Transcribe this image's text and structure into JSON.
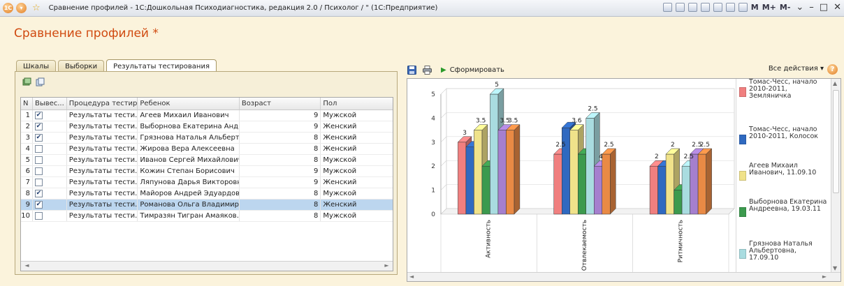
{
  "window": {
    "title": "Сравнение профилей - 1С:Дошкольная Психодиагностика, редакция 2.0 / Психолог / \" (1С:Предприятие)",
    "toolbar_m_labels": [
      "M",
      "M+",
      "M-"
    ]
  },
  "form": {
    "title": "Сравнение профилей *"
  },
  "tabs": [
    {
      "label": "Шкалы"
    },
    {
      "label": "Выборки"
    },
    {
      "label": "Результаты тестирования"
    }
  ],
  "table": {
    "columns": [
      "N",
      "Вывес...",
      "Процедура тестир...",
      "Ребенок",
      "Возраст",
      "Пол"
    ],
    "rows": [
      {
        "n": "1",
        "checked": true,
        "procedure": "Результаты тести...",
        "child": "Агеев Михаил Иванович",
        "age": "9",
        "gender": "Мужской"
      },
      {
        "n": "2",
        "checked": true,
        "procedure": "Результаты тести...",
        "child": "Выборнова Екатерина Анд...",
        "age": "9",
        "gender": "Женский"
      },
      {
        "n": "3",
        "checked": true,
        "procedure": "Результаты тести...",
        "child": "Грязнова Наталья Альберт...",
        "age": "8",
        "gender": "Женский"
      },
      {
        "n": "4",
        "checked": false,
        "procedure": "Результаты тести...",
        "child": "Жирова Вера Алексеевна",
        "age": "8",
        "gender": "Женский"
      },
      {
        "n": "5",
        "checked": false,
        "procedure": "Результаты тести...",
        "child": "Иванов Сергей Михайлович",
        "age": "8",
        "gender": "Мужской"
      },
      {
        "n": "6",
        "checked": false,
        "procedure": "Результаты тести...",
        "child": "Кожин Степан Борисович",
        "age": "9",
        "gender": "Мужской"
      },
      {
        "n": "7",
        "checked": false,
        "procedure": "Результаты тести...",
        "child": "Ляпунова Дарья Викторовна",
        "age": "9",
        "gender": "Женский"
      },
      {
        "n": "8",
        "checked": true,
        "procedure": "Результаты тести...",
        "child": "Майоров Андрей Эдуардович",
        "age": "8",
        "gender": "Мужской"
      },
      {
        "n": "9",
        "checked": true,
        "procedure": "Результаты тести...",
        "child": "Романова Ольга Владимир...",
        "age": "8",
        "gender": "Женский",
        "selected": true
      },
      {
        "n": "10",
        "checked": false,
        "procedure": "Результаты тести...",
        "child": "Тимразян Тигран Амаяков...",
        "age": "8",
        "gender": "Мужской"
      }
    ]
  },
  "right_toolbar": {
    "generate_label": "Сформировать",
    "actions_label": "Все действия ▾",
    "help_label": "?"
  },
  "icons": {
    "save": "floppy-disk-icon",
    "print": "printer-icon",
    "generate": "play-icon",
    "help": "question-icon",
    "table_add": "add-rows-icon",
    "table_copy": "copy-icon"
  },
  "chart_data": {
    "type": "bar",
    "categories": [
      "Активность",
      "Отвлекаемость",
      "Ритмичность"
    ],
    "ylim": [
      0,
      5
    ],
    "yticks": [
      0,
      1,
      2,
      3,
      4,
      5
    ],
    "series": [
      {
        "name": "Томас-Чесс, начало 2010-2011, Земляничка",
        "color": "#f07f7f",
        "values": [
          3,
          2.5,
          2
        ]
      },
      {
        "name": "Томас-Чесс, начало 2010-2011, Колосок",
        "color": "#2f69c0",
        "values": [
          2.8,
          3.6,
          2
        ]
      },
      {
        "name": "Агеев Михаил Иванович, 11.09.10",
        "color": "#f0e28a",
        "values": [
          3.5,
          3.5,
          2.5
        ]
      },
      {
        "name": "Выборнова Екатерина Андреевна, 19.03.11",
        "color": "#3c9a4e",
        "values": [
          2,
          2.5,
          1
        ]
      },
      {
        "name": "Грязнова Наталья Альбертовна, 17.09.10",
        "color": "#a9dce0",
        "values": [
          5,
          4,
          2
        ]
      },
      {
        "name": "",
        "color": "#a57fce",
        "values": [
          3.5,
          2,
          2.5
        ]
      },
      {
        "name": "",
        "color": "#e98a45",
        "values": [
          3.5,
          2.5,
          2.5
        ]
      }
    ],
    "value_labels": [
      [
        "3",
        "3.5",
        "5",
        "3.5",
        "3.5"
      ],
      [
        "2.5",
        "3.6",
        "2.5",
        "4",
        "2.5"
      ],
      [
        "2",
        "2",
        "2.5",
        "2.5",
        "2.5"
      ]
    ]
  }
}
